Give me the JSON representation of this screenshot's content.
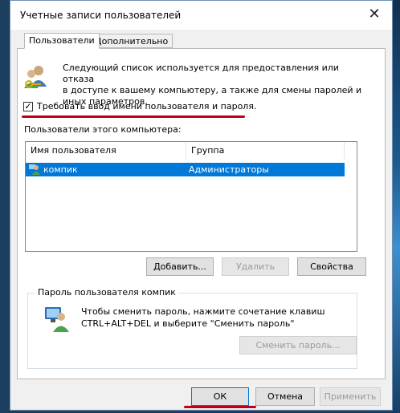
{
  "window": {
    "title": "Учетные записи пользователей"
  },
  "tabs": [
    {
      "label": "Пользователи",
      "active": true
    },
    {
      "label": "Дополнительно",
      "active": false
    }
  ],
  "info": {
    "line1": "Следующий список используется для предоставления или отказа",
    "line2": "в доступе к вашему компьютеру, а также для смены паролей и",
    "line3": "иных параметров."
  },
  "require_login": {
    "label": "Требовать ввод имени пользователя и пароля.",
    "checked": true
  },
  "users_list": {
    "label": "Пользователи этого компьютера:",
    "columns": [
      "Имя пользователя",
      "Группа"
    ],
    "rows": [
      {
        "name": "компик",
        "group": "Администраторы",
        "selected": true
      }
    ]
  },
  "list_buttons": {
    "add": "Добавить...",
    "remove": "Удалить",
    "properties": "Свойства"
  },
  "password_group": {
    "title": "Пароль пользователя компик",
    "line1": "Чтобы сменить пароль, нажмите сочетание клавиш",
    "line2": "CTRL+ALT+DEL и выберите \"Сменить пароль\"",
    "button": "Сменить пароль..."
  },
  "footer": {
    "ok": "ОК",
    "cancel": "Отмена",
    "apply": "Применить"
  },
  "colors": {
    "selection": "#0078d7",
    "annotation_underline": "#c00018"
  }
}
